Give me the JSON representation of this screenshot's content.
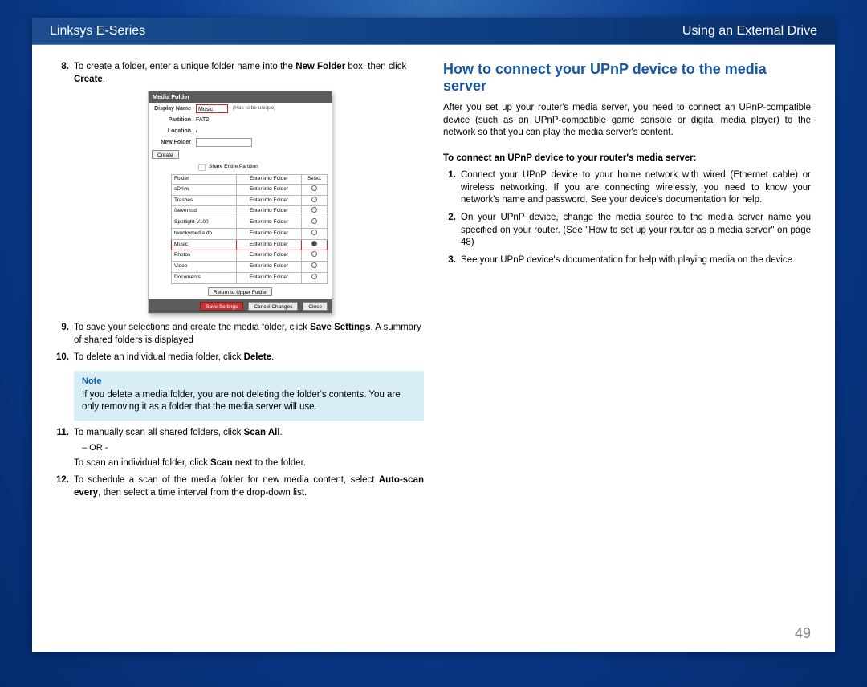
{
  "header": {
    "left": "Linksys E-Series",
    "right": "Using an External Drive"
  },
  "left_column": {
    "items": [
      {
        "num": "8.",
        "pre": "To create a folder, enter a unique folder name into the ",
        "bold1": "New Folder",
        "mid": " box, then click ",
        "bold2": "Create",
        "post": "."
      },
      {
        "num": "9.",
        "pre": "To save your selections and create the media folder, click ",
        "bold1": "Save Settings",
        "mid": ". A summary of shared folders is displayed",
        "bold2": "",
        "post": ""
      },
      {
        "num": "10.",
        "pre": "To delete an individual media folder, click ",
        "bold1": "Delete",
        "mid": ".",
        "bold2": "",
        "post": ""
      },
      {
        "num": "11.",
        "pre": "To manually scan all shared folders, click ",
        "bold1": "Scan All",
        "mid": ".",
        "bold2": "",
        "post": ""
      },
      {
        "num": "12.",
        "pre": "To schedule a scan of the media folder for new media content, select ",
        "bold1": "Auto-scan every",
        "mid": ", then select a time interval from the drop-down list.",
        "bold2": "",
        "post": ""
      }
    ],
    "or_text": "– OR -",
    "scan_individual": {
      "pre": "To scan an individual folder, click ",
      "bold": "Scan",
      "post": " next to the folder."
    },
    "note": {
      "title": "Note",
      "body": "If you delete a media folder, you are not deleting the folder's contents. You are only removing it as a folder that the media server will use."
    }
  },
  "right_column": {
    "heading": "How to connect your UPnP device to the media server",
    "intro": "After you set up your router's media server, you need to connect an UPnP-compatible device (such as an UPnP-compatible game console or digital media player) to the network so that you can play the media server's content.",
    "sub": "To connect an UPnP device to your router's media server:",
    "steps": [
      {
        "num": "1.",
        "txt": "Connect your UPnP device to your home network with wired (Ethernet cable) or wireless networking. If you are connecting wirelessly, you need to know your network's name and password. See your device's documentation for help."
      },
      {
        "num": "2.",
        "txt": "On your UPnP device, change the media source to the media server name you specified on your router. (See \"How to set up your router as a media server\" on page 48)"
      },
      {
        "num": "3.",
        "txt": "See your UPnP device's documentation for help with playing media on the device."
      }
    ]
  },
  "media_shot": {
    "title": "Media Folder",
    "display_name_label": "Display Name",
    "display_name_value": "Music",
    "display_hint": "(Has to be unique)",
    "partition_label": "Partition",
    "partition_value": "FAT2",
    "location_label": "Location",
    "location_value": "/",
    "newfolder_label": "New Folder",
    "create_btn": "Create",
    "share_label": "Share Entire Partition",
    "rows": [
      {
        "name": "Folder",
        "action": "Enter into Folder",
        "sel": "select",
        "hl": false
      },
      {
        "name": "sDrive",
        "action": "Enter into Folder",
        "sel": "o",
        "hl": false
      },
      {
        "name": "Trashes",
        "action": "Enter into Folder",
        "sel": "o",
        "hl": false
      },
      {
        "name": "fseventsd",
        "action": "Enter into Folder",
        "sel": "o",
        "hl": false
      },
      {
        "name": "Spotlight-V100",
        "action": "Enter into Folder",
        "sel": "o",
        "hl": false
      },
      {
        "name": "twonkymedia db",
        "action": "Enter into Folder",
        "sel": "o",
        "hl": false
      },
      {
        "name": "Music",
        "action": "Enter into Folder",
        "sel": "●",
        "hl": true
      },
      {
        "name": "Photos",
        "action": "Enter into Folder",
        "sel": "o",
        "hl": false
      },
      {
        "name": "Video",
        "action": "Enter into Folder",
        "sel": "o",
        "hl": false
      },
      {
        "name": "Documents",
        "action": "Enter into Folder",
        "sel": "o",
        "hl": false
      }
    ],
    "return_btn": "Return to Upper Folder",
    "save_btn": "Save Settings",
    "cancel_btn": "Cancel Changes",
    "close_btn": "Close"
  },
  "page_number": "49"
}
